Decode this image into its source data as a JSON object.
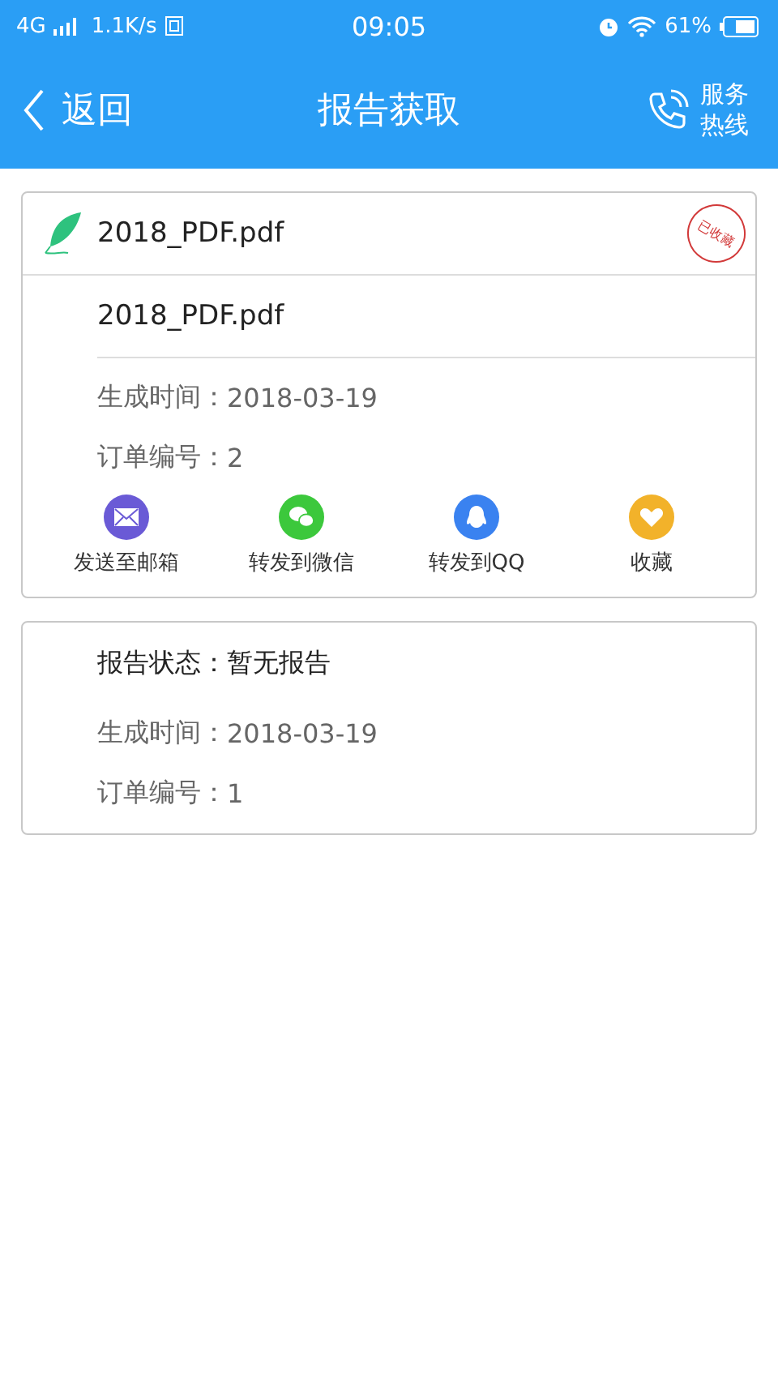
{
  "status_bar": {
    "network": "4G",
    "speed": "1.1K/s",
    "time": "09:05",
    "battery": "61%"
  },
  "header": {
    "back": "返回",
    "title": "报告获取",
    "hotline": [
      "服务",
      "热线"
    ]
  },
  "reports": [
    {
      "kind": "file",
      "file_name": "2018_PDF.pdf",
      "stamp": "已收藏",
      "subtitle": "2018_PDF.pdf",
      "fields": [
        {
          "label": "生成时间：",
          "value": "2018-03-19"
        },
        {
          "label": "订单编号：",
          "value": "2"
        }
      ],
      "actions": [
        {
          "kind": "mail",
          "label": "发送至邮箱",
          "color": "#6a5ad6"
        },
        {
          "kind": "wechat",
          "label": "转发到微信",
          "color": "#3cc83c"
        },
        {
          "kind": "qq",
          "label": "转发到QQ",
          "color": "#3a82f0"
        },
        {
          "kind": "favorite",
          "label": "收藏",
          "color": "#f2b22a"
        }
      ]
    },
    {
      "kind": "status",
      "status_label": "报告状态：",
      "status_value": "暂无报告",
      "fields": [
        {
          "label": "生成时间：",
          "value": "2018-03-19"
        },
        {
          "label": "订单编号：",
          "value": "1"
        }
      ]
    }
  ]
}
